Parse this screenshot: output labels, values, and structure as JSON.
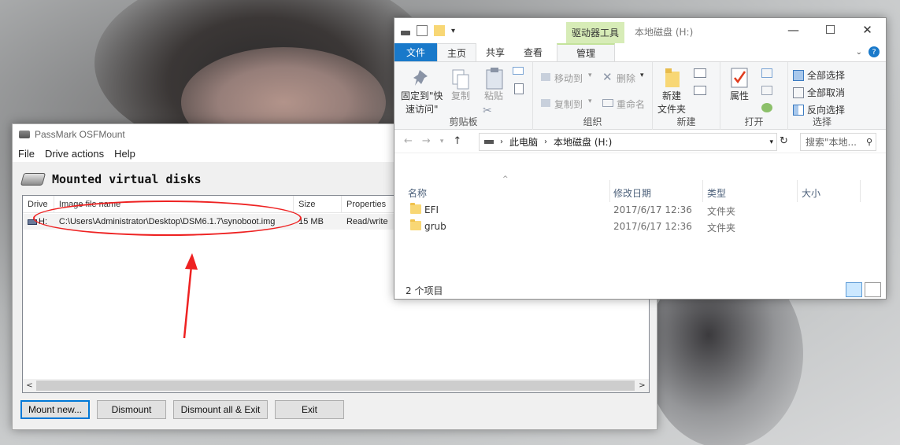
{
  "osfmount": {
    "title": "PassMark OSFMount",
    "menu": [
      "File",
      "Drive actions",
      "Help"
    ],
    "header_title": "Mounted virtual disks",
    "columns": [
      "Drive",
      "Image file name",
      "Size",
      "Properties"
    ],
    "rows": [
      {
        "drive": "H:",
        "image": "C:\\Users\\Administrator\\Desktop\\DSM6.1.7\\synoboot.img",
        "size": "15 MB",
        "properties": "Read/write"
      }
    ],
    "buttons": {
      "mount": "Mount new...",
      "dismount": "Dismount",
      "dismount_all": "Dismount all & Exit",
      "exit": "Exit"
    },
    "scroll_left": "<",
    "scroll_right": ">"
  },
  "explorer": {
    "title": "本地磁盘 (H:)",
    "tool_tab": "驱动器工具",
    "win_controls": {
      "minimize": "—",
      "maximize": "☐",
      "close": "✕"
    },
    "tabs": {
      "file": "文件",
      "home": "主页",
      "share": "共享",
      "view": "查看",
      "manage": "管理"
    },
    "ribbon": {
      "clipboard": {
        "pin": "固定到\"快",
        "pin2": "速访问\"",
        "copy": "复制",
        "paste": "粘贴",
        "name": "剪贴板"
      },
      "organize": {
        "move": "移动到",
        "copy_to": "复制到",
        "delete": "删除",
        "rename": "重命名",
        "name": "组织"
      },
      "new": {
        "folder": "新建",
        "folder2": "文件夹",
        "name": "新建"
      },
      "open": {
        "props": "属性",
        "name": "打开"
      },
      "select": {
        "all": "全部选择",
        "none": "全部取消",
        "invert": "反向选择",
        "name": "选择"
      }
    },
    "address": {
      "pc": "此电脑",
      "drive": "本地磁盘 (H:)"
    },
    "search_placeholder": "搜索\"本地...",
    "columns": {
      "name": "名称",
      "date": "修改日期",
      "type": "类型",
      "size": "大小"
    },
    "files": [
      {
        "name": "EFI",
        "date": "2017/6/17 12:36",
        "type": "文件夹"
      },
      {
        "name": "grub",
        "date": "2017/6/17 12:36",
        "type": "文件夹"
      }
    ],
    "status": "2 个项目"
  }
}
